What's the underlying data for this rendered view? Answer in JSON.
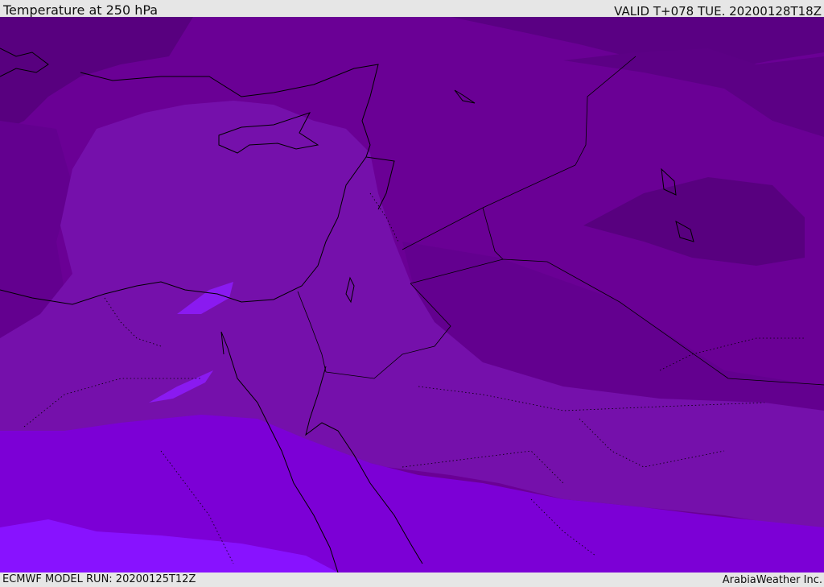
{
  "header": {
    "title": "Temperature at 250 hPa",
    "valid_time": "VALID T+078 TUE. 20200128T18Z"
  },
  "footer": {
    "model_run": "ECMWF MODEL RUN: 20200125T12Z",
    "credit": "ArabiaWeather Inc."
  },
  "map": {
    "field": "temperature",
    "level": "250 hPa",
    "colors": {
      "band_dark": "#58007f",
      "band_mid_dark": "#63008f",
      "band_mid": "#6a0095",
      "band_light": "#7510ab",
      "band_violet": "#7c00d6",
      "band_bright_violet": "#8812ff",
      "coastline": "#000000"
    }
  }
}
